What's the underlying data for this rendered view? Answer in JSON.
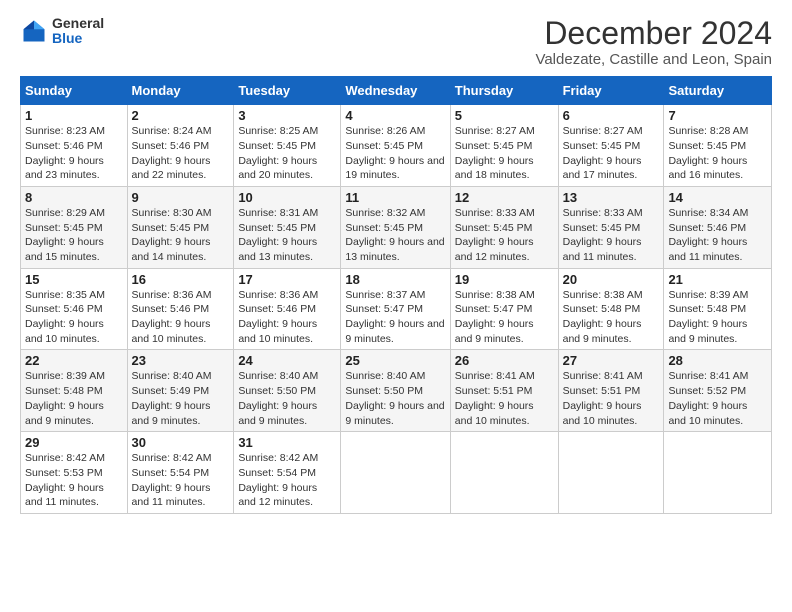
{
  "logo": {
    "general": "General",
    "blue": "Blue"
  },
  "title": "December 2024",
  "subtitle": "Valdezate, Castille and Leon, Spain",
  "calendar": {
    "headers": [
      "Sunday",
      "Monday",
      "Tuesday",
      "Wednesday",
      "Thursday",
      "Friday",
      "Saturday"
    ],
    "weeks": [
      [
        {
          "day": "1",
          "sunrise": "8:23 AM",
          "sunset": "5:46 PM",
          "daylight": "9 hours and 23 minutes."
        },
        {
          "day": "2",
          "sunrise": "8:24 AM",
          "sunset": "5:46 PM",
          "daylight": "9 hours and 22 minutes."
        },
        {
          "day": "3",
          "sunrise": "8:25 AM",
          "sunset": "5:45 PM",
          "daylight": "9 hours and 20 minutes."
        },
        {
          "day": "4",
          "sunrise": "8:26 AM",
          "sunset": "5:45 PM",
          "daylight": "9 hours and 19 minutes."
        },
        {
          "day": "5",
          "sunrise": "8:27 AM",
          "sunset": "5:45 PM",
          "daylight": "9 hours and 18 minutes."
        },
        {
          "day": "6",
          "sunrise": "8:27 AM",
          "sunset": "5:45 PM",
          "daylight": "9 hours and 17 minutes."
        },
        {
          "day": "7",
          "sunrise": "8:28 AM",
          "sunset": "5:45 PM",
          "daylight": "9 hours and 16 minutes."
        }
      ],
      [
        {
          "day": "8",
          "sunrise": "8:29 AM",
          "sunset": "5:45 PM",
          "daylight": "9 hours and 15 minutes."
        },
        {
          "day": "9",
          "sunrise": "8:30 AM",
          "sunset": "5:45 PM",
          "daylight": "9 hours and 14 minutes."
        },
        {
          "day": "10",
          "sunrise": "8:31 AM",
          "sunset": "5:45 PM",
          "daylight": "9 hours and 13 minutes."
        },
        {
          "day": "11",
          "sunrise": "8:32 AM",
          "sunset": "5:45 PM",
          "daylight": "9 hours and 13 minutes."
        },
        {
          "day": "12",
          "sunrise": "8:33 AM",
          "sunset": "5:45 PM",
          "daylight": "9 hours and 12 minutes."
        },
        {
          "day": "13",
          "sunrise": "8:33 AM",
          "sunset": "5:45 PM",
          "daylight": "9 hours and 11 minutes."
        },
        {
          "day": "14",
          "sunrise": "8:34 AM",
          "sunset": "5:46 PM",
          "daylight": "9 hours and 11 minutes."
        }
      ],
      [
        {
          "day": "15",
          "sunrise": "8:35 AM",
          "sunset": "5:46 PM",
          "daylight": "9 hours and 10 minutes."
        },
        {
          "day": "16",
          "sunrise": "8:36 AM",
          "sunset": "5:46 PM",
          "daylight": "9 hours and 10 minutes."
        },
        {
          "day": "17",
          "sunrise": "8:36 AM",
          "sunset": "5:46 PM",
          "daylight": "9 hours and 10 minutes."
        },
        {
          "day": "18",
          "sunrise": "8:37 AM",
          "sunset": "5:47 PM",
          "daylight": "9 hours and 9 minutes."
        },
        {
          "day": "19",
          "sunrise": "8:38 AM",
          "sunset": "5:47 PM",
          "daylight": "9 hours and 9 minutes."
        },
        {
          "day": "20",
          "sunrise": "8:38 AM",
          "sunset": "5:48 PM",
          "daylight": "9 hours and 9 minutes."
        },
        {
          "day": "21",
          "sunrise": "8:39 AM",
          "sunset": "5:48 PM",
          "daylight": "9 hours and 9 minutes."
        }
      ],
      [
        {
          "day": "22",
          "sunrise": "8:39 AM",
          "sunset": "5:48 PM",
          "daylight": "9 hours and 9 minutes."
        },
        {
          "day": "23",
          "sunrise": "8:40 AM",
          "sunset": "5:49 PM",
          "daylight": "9 hours and 9 minutes."
        },
        {
          "day": "24",
          "sunrise": "8:40 AM",
          "sunset": "5:50 PM",
          "daylight": "9 hours and 9 minutes."
        },
        {
          "day": "25",
          "sunrise": "8:40 AM",
          "sunset": "5:50 PM",
          "daylight": "9 hours and 9 minutes."
        },
        {
          "day": "26",
          "sunrise": "8:41 AM",
          "sunset": "5:51 PM",
          "daylight": "9 hours and 10 minutes."
        },
        {
          "day": "27",
          "sunrise": "8:41 AM",
          "sunset": "5:51 PM",
          "daylight": "9 hours and 10 minutes."
        },
        {
          "day": "28",
          "sunrise": "8:41 AM",
          "sunset": "5:52 PM",
          "daylight": "9 hours and 10 minutes."
        }
      ],
      [
        {
          "day": "29",
          "sunrise": "8:42 AM",
          "sunset": "5:53 PM",
          "daylight": "9 hours and 11 minutes."
        },
        {
          "day": "30",
          "sunrise": "8:42 AM",
          "sunset": "5:54 PM",
          "daylight": "9 hours and 11 minutes."
        },
        {
          "day": "31",
          "sunrise": "8:42 AM",
          "sunset": "5:54 PM",
          "daylight": "9 hours and 12 minutes."
        },
        null,
        null,
        null,
        null
      ]
    ]
  }
}
